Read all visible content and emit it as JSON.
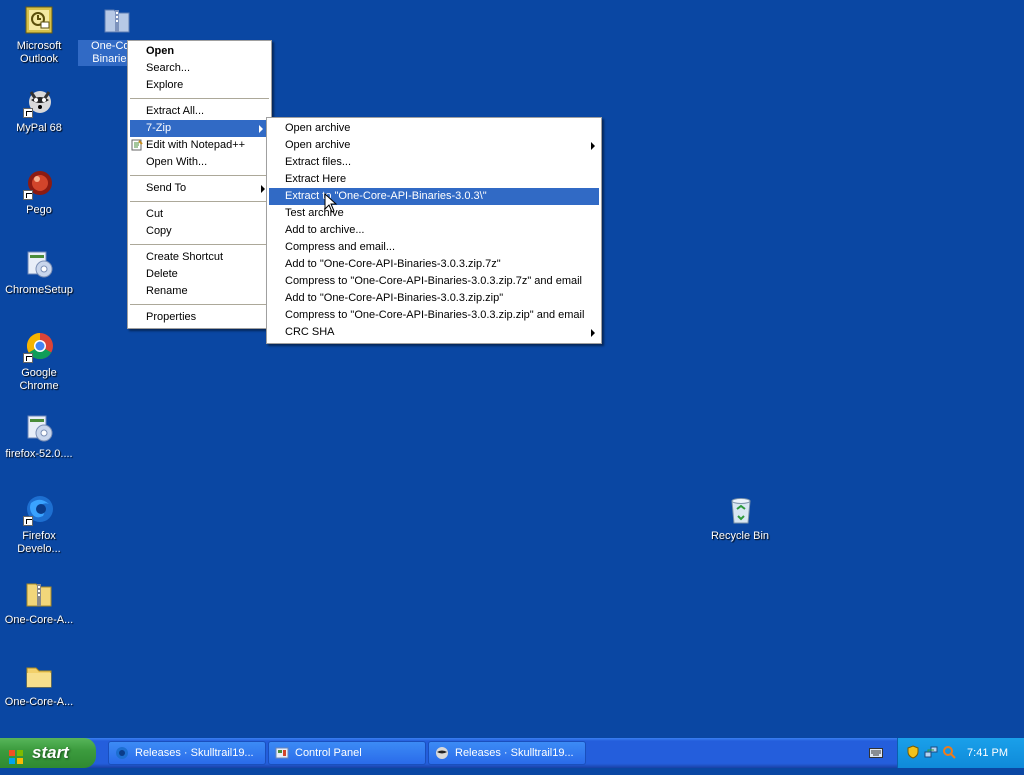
{
  "desktop": {
    "icons": [
      {
        "label": "Microsoft\nOutlook",
        "label1": "Microsoft",
        "label2": "Outlook"
      },
      {
        "label1": "One-Core-",
        "label2": "Binaries-3"
      },
      {
        "label1": "MyPal 68"
      },
      {
        "label1": "Pego"
      },
      {
        "label1": "ChromeSetup"
      },
      {
        "label1": "Google Chrome"
      },
      {
        "label1": "firefox-52.0...."
      },
      {
        "label1": "Firefox",
        "label2": "Develo..."
      },
      {
        "label1": "One-Core-A..."
      },
      {
        "label1": "One-Core-A..."
      },
      {
        "label1": "Recycle Bin"
      }
    ]
  },
  "context_menu": {
    "open": "Open",
    "search": "Search...",
    "explore": "Explore",
    "extract_all": "Extract All...",
    "seven_zip": "7-Zip",
    "edit_notepad": "Edit with Notepad++",
    "open_with": "Open With...",
    "send_to": "Send To",
    "cut": "Cut",
    "copy": "Copy",
    "create_shortcut": "Create Shortcut",
    "delete": "Delete",
    "rename": "Rename",
    "properties": "Properties"
  },
  "seven_zip_menu": {
    "items": [
      "Open archive",
      "Open archive",
      "Extract files...",
      "Extract Here",
      "Extract to \"One-Core-API-Binaries-3.0.3\\\"",
      "Test archive",
      "Add to archive...",
      "Compress and email...",
      "Add to \"One-Core-API-Binaries-3.0.3.zip.7z\"",
      "Compress to \"One-Core-API-Binaries-3.0.3.zip.7z\" and email",
      "Add to \"One-Core-API-Binaries-3.0.3.zip.zip\"",
      "Compress to \"One-Core-API-Binaries-3.0.3.zip.zip\" and email",
      "CRC SHA"
    ]
  },
  "taskbar": {
    "start_label": "start",
    "tasks": [
      "Releases · Skulltrail19...",
      "Control Panel",
      "Releases · Skulltrail19..."
    ],
    "clock": "7:41 PM"
  },
  "colors": {
    "desktop": "#0a47a3",
    "highlight": "#316ac5",
    "start_green": "#3c9c3e"
  }
}
